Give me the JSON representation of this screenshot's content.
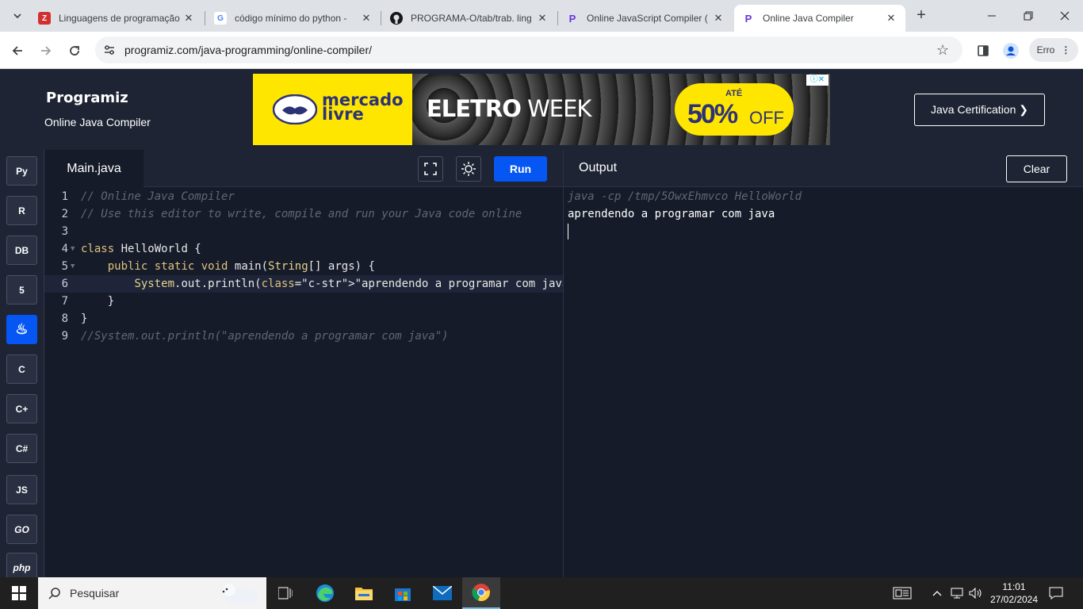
{
  "browser": {
    "tabs": [
      {
        "title": "Linguagens de programação",
        "favicon": "Z",
        "favicon_color": "#d32f2f",
        "active": false
      },
      {
        "title": "código mínimo do python -",
        "favicon": "G",
        "favicon_color": "#4285f4",
        "active": false
      },
      {
        "title": "PROGRAMA-O/tab/trab. ling",
        "favicon": "github",
        "favicon_color": "#181717",
        "active": false
      },
      {
        "title": "Online JavaScript Compiler (",
        "favicon": "P",
        "favicon_color": "#6b31e4",
        "active": false
      },
      {
        "title": "Online Java Compiler",
        "favicon": "P",
        "favicon_color": "#6b31e4",
        "active": true
      }
    ],
    "url": "programiz.com/java-programming/online-compiler/",
    "profile_label": "Erro"
  },
  "site": {
    "logo": "Programiz",
    "subtitle": "Online Java Compiler",
    "cert_button": "Java Certification ❯",
    "ad": {
      "brand": "mercado livre",
      "headline_bold": "ELETRO",
      "headline_rest": " WEEK",
      "badge_top": "ATÉ",
      "badge_pct": "50%",
      "badge_off": "OFF"
    }
  },
  "sidebar": {
    "languages": [
      {
        "name": "python-icon",
        "label": "Py"
      },
      {
        "name": "r-icon",
        "label": "R"
      },
      {
        "name": "sql-icon",
        "label": "DB"
      },
      {
        "name": "html5-icon",
        "label": "5"
      },
      {
        "name": "java-icon",
        "label": "♨",
        "active": true
      },
      {
        "name": "c-icon",
        "label": "C"
      },
      {
        "name": "cpp-icon",
        "label": "C+"
      },
      {
        "name": "csharp-icon",
        "label": "C#"
      },
      {
        "name": "js-icon",
        "label": "JS"
      },
      {
        "name": "go-icon",
        "label": "GO"
      },
      {
        "name": "php-icon",
        "label": "php"
      }
    ]
  },
  "editor": {
    "filename": "Main.java",
    "run_label": "Run",
    "code_lines": [
      {
        "n": "1",
        "text": "// Online Java Compiler"
      },
      {
        "n": "2",
        "text": "// Use this editor to write, compile and run your Java code online"
      },
      {
        "n": "3",
        "text": ""
      },
      {
        "n": "4",
        "text": "class HelloWorld {"
      },
      {
        "n": "5",
        "text": "    public static void main(String[] args) {"
      },
      {
        "n": "6",
        "text": "        System.out.println(\"aprendendo a programar com java\");"
      },
      {
        "n": "7",
        "text": "    }"
      },
      {
        "n": "8",
        "text": "}"
      },
      {
        "n": "9",
        "text": "//System.out.println(\"aprendendo a programar com java\")"
      }
    ]
  },
  "output": {
    "title": "Output",
    "clear_label": "Clear",
    "command": "java -cp /tmp/5OwxEhmvco HelloWorld",
    "result": "aprendendo a programar com java"
  },
  "taskbar": {
    "search_placeholder": "Pesquisar",
    "time": "11:01",
    "date": "27/02/2024"
  }
}
